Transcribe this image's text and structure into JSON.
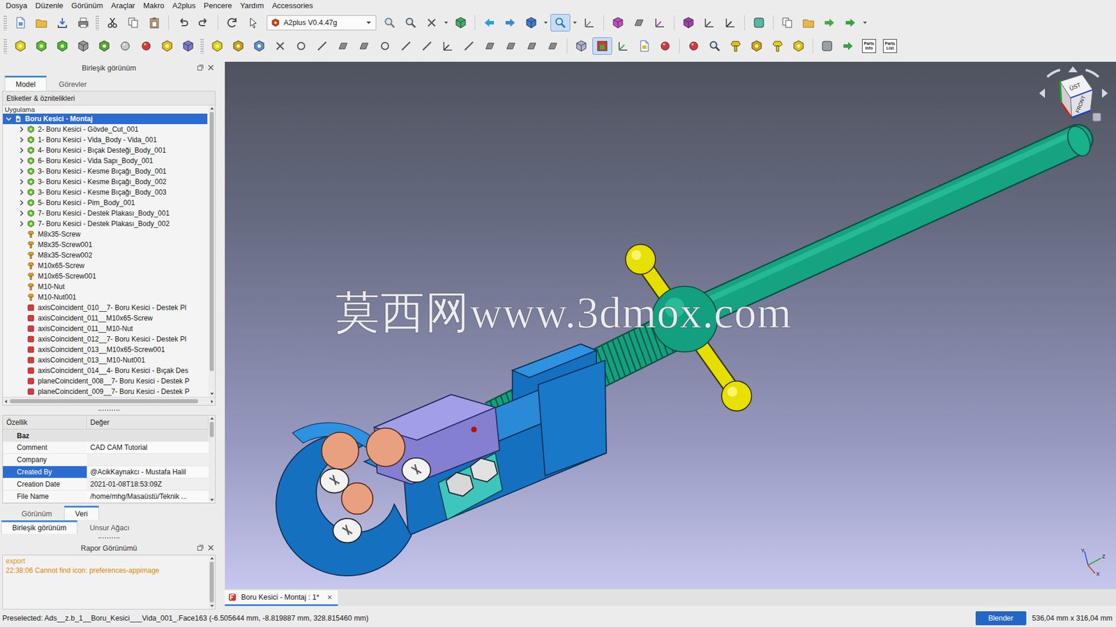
{
  "menu": [
    "Dosya",
    "Düzenle",
    "Görünüm",
    "Araçlar",
    "Makro",
    "A2plus",
    "Pencere",
    "Yardım",
    "Accessories"
  ],
  "toolbars": {
    "workbench": "A2plus V0.4.47g",
    "active_tools": [
      "select-filter",
      "auto-solve"
    ],
    "icon_labels": [
      {
        "lines": [
          "Parts",
          "Info"
        ]
      },
      {
        "lines": [
          "Parts",
          "List"
        ]
      }
    ]
  },
  "combo_view": {
    "title": "Birleşik görünüm",
    "tabs": [
      {
        "label": "Model",
        "selected": true
      },
      {
        "label": "Görevler",
        "selected": false
      }
    ],
    "tree_header": "Etiketler & öznitelikleri",
    "app_label": "Uygulama",
    "v_scroll_level": 0.93,
    "h_scroll_level": 0.95,
    "tree": [
      {
        "label": "Boru Kesici - Montaj",
        "kind": "assembly",
        "level": 0,
        "expandable": true,
        "expanded": true,
        "selected": true
      },
      {
        "label": "2- Boru Kesici - Gövde_Cut_001",
        "kind": "part",
        "level": 1,
        "expandable": true,
        "expanded": false,
        "selected": false
      },
      {
        "label": "1- Boru Kesici - Vida_Body - Vida_001",
        "kind": "part",
        "level": 1,
        "expandable": true,
        "expanded": false,
        "selected": false
      },
      {
        "label": "4- Boru Kesici - Bıçak Desteği_Body_001",
        "kind": "part",
        "level": 1,
        "expandable": true,
        "expanded": false,
        "selected": false
      },
      {
        "label": "6- Boru Kesici - Vida Sapı_Body_001",
        "kind": "part",
        "level": 1,
        "expandable": true,
        "expanded": false,
        "selected": false
      },
      {
        "label": "3- Boru Kesici - Kesme Bıçağı_Body_001",
        "kind": "part",
        "level": 1,
        "expandable": true,
        "expanded": false,
        "selected": false
      },
      {
        "label": "3- Boru Kesici - Kesme Bıçağı_Body_002",
        "kind": "part",
        "level": 1,
        "expandable": true,
        "expanded": false,
        "selected": false
      },
      {
        "label": "3- Boru Kesici - Kesme Bıçağı_Body_003",
        "kind": "part",
        "level": 1,
        "expandable": true,
        "expanded": false,
        "selected": false
      },
      {
        "label": "5- Boru Kesici - Pim_Body_001",
        "kind": "part",
        "level": 1,
        "expandable": true,
        "expanded": false,
        "selected": false
      },
      {
        "label": "7- Boru Kesici - Destek Plakası_Body_001",
        "kind": "part",
        "level": 1,
        "expandable": true,
        "expanded": false,
        "selected": false
      },
      {
        "label": "7- Boru Kesici - Destek Plakası_Body_002",
        "kind": "part",
        "level": 1,
        "expandable": true,
        "expanded": false,
        "selected": false
      },
      {
        "label": "M8x35-Screw",
        "kind": "fastener",
        "level": 1,
        "expandable": false,
        "expanded": false,
        "selected": false
      },
      {
        "label": "M8x35-Screw001",
        "kind": "fastener",
        "level": 1,
        "expandable": false,
        "expanded": false,
        "selected": false
      },
      {
        "label": "M8x35-Screw002",
        "kind": "fastener",
        "level": 1,
        "expandable": false,
        "expanded": false,
        "selected": false
      },
      {
        "label": "M10x65-Screw",
        "kind": "fastener",
        "level": 1,
        "expandable": false,
        "expanded": false,
        "selected": false
      },
      {
        "label": "M10x65-Screw001",
        "kind": "fastener",
        "level": 1,
        "expandable": false,
        "expanded": false,
        "selected": false
      },
      {
        "label": "M10-Nut",
        "kind": "fastener",
        "level": 1,
        "expandable": false,
        "expanded": false,
        "selected": false
      },
      {
        "label": "M10-Nut001",
        "kind": "fastener",
        "level": 1,
        "expandable": false,
        "expanded": false,
        "selected": false
      },
      {
        "label": "axisCoincident_010__7- Boru Kesici - Destek Pl",
        "kind": "constraint",
        "level": 1,
        "expandable": false,
        "expanded": false,
        "selected": false
      },
      {
        "label": "axisCoincident_011__M10x65-Screw",
        "kind": "constraint",
        "level": 1,
        "expandable": false,
        "expanded": false,
        "selected": false
      },
      {
        "label": "axisCoincident_011__M10-Nut",
        "kind": "constraint",
        "level": 1,
        "expandable": false,
        "expanded": false,
        "selected": false
      },
      {
        "label": "axisCoincident_012__7- Boru Kesici - Destek Pl",
        "kind": "constraint",
        "level": 1,
        "expandable": false,
        "expanded": false,
        "selected": false
      },
      {
        "label": "axisCoincident_013__M10x65-Screw001",
        "kind": "constraint",
        "level": 1,
        "expandable": false,
        "expanded": false,
        "selected": false
      },
      {
        "label": "axisCoincident_013__M10-Nut001",
        "kind": "constraint",
        "level": 1,
        "expandable": false,
        "expanded": false,
        "selected": false
      },
      {
        "label": "axisCoincident_014__4- Boru Kesici - Bıçak Des",
        "kind": "constraint",
        "level": 1,
        "expandable": false,
        "expanded": false,
        "selected": false
      },
      {
        "label": "planeCoincident_008__7- Boru Kesici - Destek P",
        "kind": "constraint",
        "level": 1,
        "expandable": false,
        "expanded": false,
        "selected": false
      },
      {
        "label": "planeCoincident_009__7- Boru Kesici - Destek P",
        "kind": "constraint",
        "level": 1,
        "expandable": false,
        "expanded": false,
        "selected": false
      }
    ]
  },
  "properties": {
    "columns": [
      "Özellik",
      "Değer"
    ],
    "group": "Baz",
    "v_scroll_level": 0.2,
    "rows": [
      {
        "name": "Comment",
        "value": "CAD CAM Tutorial",
        "selected": false
      },
      {
        "name": "Company",
        "value": "",
        "selected": false
      },
      {
        "name": "Created By",
        "value": "@AcikKaynakcı - Mustafa Halil",
        "selected": true
      },
      {
        "name": "Creation Date",
        "value": "2021-01-08T18:53:09Z",
        "selected": false
      },
      {
        "name": "File Name",
        "value": "/home/mhg/Masaüstü/Teknik ...",
        "selected": false
      }
    ]
  },
  "property_tabs": [
    {
      "label": "Görünüm",
      "selected": false
    },
    {
      "label": "Veri",
      "selected": true
    }
  ],
  "view_tabs": [
    {
      "label": "Birleşik görünüm",
      "selected": true
    },
    {
      "label": "Unsur Ağacı",
      "selected": false
    }
  ],
  "report": {
    "title": "Rapor Görünümü",
    "lines": [
      {
        "text": "export",
        "color": "#d89a1c"
      },
      {
        "text": "22:38:06  Cannot find icon: preferences-appimage",
        "color": "#e0860a"
      }
    ]
  },
  "viewport": {
    "watermark": "莫西网www.3dmox.com",
    "navcube_labels": [
      "ÜST",
      "FRONT"
    ],
    "axes": [
      "X",
      "Y",
      "Z"
    ]
  },
  "document_tabs": [
    {
      "label": "Boru Kesici - Montaj : 1*",
      "selected": true,
      "close": "×"
    }
  ],
  "status_bar": {
    "message": "Preselected: Ads__z.b_1__Boru_Kesici___Vida_001_.Face163 (-6.505644 mm, -8.819887 mm, 328.815460 mm)",
    "renderer": "Blender",
    "dimensions": "536,04 mm x 316,04 mm"
  }
}
